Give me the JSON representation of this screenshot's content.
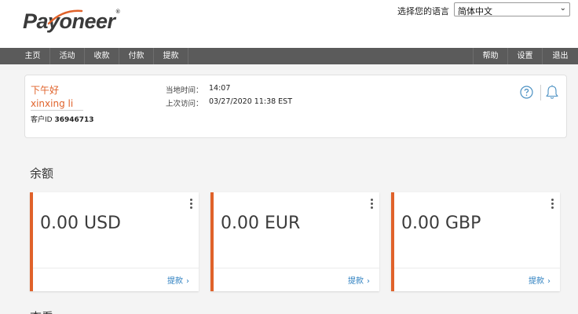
{
  "header": {
    "logo_text": "Payoneer",
    "language_label": "选择您的语言",
    "language_selected": "简体中文"
  },
  "nav": {
    "left": [
      "主页",
      "活动",
      "收款",
      "付款",
      "提款"
    ],
    "right": [
      "帮助",
      "设置",
      "退出"
    ]
  },
  "account": {
    "greeting": "下午好",
    "username": "xinxing li",
    "client_id_label": "客户ID",
    "client_id": "36946713",
    "local_time_label": "当地时间：",
    "local_time": "14:07",
    "last_visit_label": "上次访问：",
    "last_visit": "03/27/2020 11:38 EST"
  },
  "balances": {
    "title": "余额",
    "items": [
      {
        "amount": "0.00 USD",
        "action": "提款"
      },
      {
        "amount": "0.00 EUR",
        "action": "提款"
      },
      {
        "amount": "0.00 GBP",
        "action": "提款"
      }
    ],
    "arrow": "›"
  },
  "next_section": {
    "title": "查看"
  },
  "colors": {
    "accent": "#e0622a",
    "nav_bg": "#5b5b5b",
    "link": "#2c7fc0",
    "icon": "#4a90c2"
  }
}
